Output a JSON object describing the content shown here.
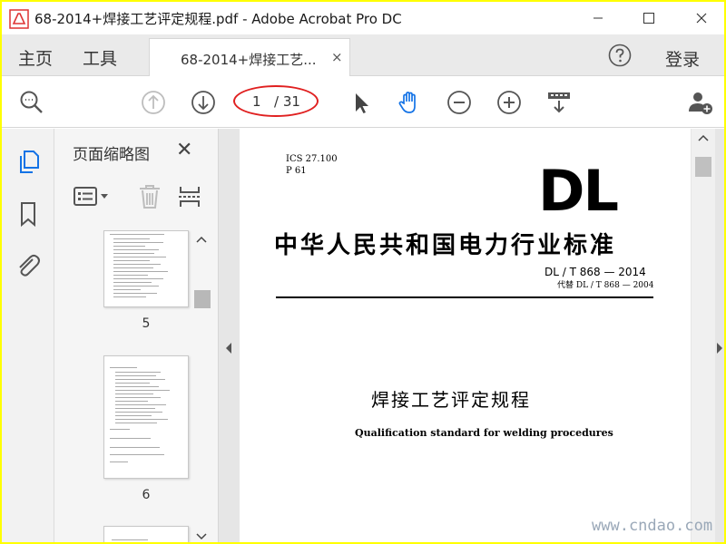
{
  "window": {
    "title": "68-2014+焊接工艺评定规程.pdf - Adobe Acrobat Pro DC"
  },
  "tabbar": {
    "home": "主页",
    "tools": "工具",
    "doc_tab": "68-2014+焊接工艺...",
    "doc_tab_close": "×",
    "login": "登录"
  },
  "toolbar": {
    "page_current": "1",
    "page_total": "/ 31"
  },
  "thumb_panel": {
    "title": "页面缩略图",
    "close": "✕",
    "pages": [
      "5",
      "6"
    ]
  },
  "document": {
    "ics": "ICS 27.100",
    "code": "P 61",
    "logo": "DL",
    "standard_title": "中华人民共和国电力行业标准",
    "standard_number": "DL / T  868 — 2014",
    "replaces": "代替 DL / T  868 — 2004",
    "title_cn": "焊接工艺评定规程",
    "title_en": "Qualification standard for welding procedures"
  },
  "watermark": "www.cndao.com",
  "colors": {
    "accent_blue": "#1473e6",
    "annotation_red": "#e02020",
    "border_yellow": "#ffff00"
  },
  "icons": [
    "app-logo-icon",
    "minimize-icon",
    "maximize-icon",
    "close-icon",
    "help-icon",
    "search-icon",
    "prev-page-icon",
    "next-page-icon",
    "select-cursor-icon",
    "hand-tool-icon",
    "zoom-out-icon",
    "zoom-in-icon",
    "page-display-icon",
    "add-user-icon",
    "thumbnails-icon",
    "bookmark-icon",
    "attachment-icon",
    "thumbnail-options-icon",
    "delete-icon",
    "extract-icon"
  ]
}
